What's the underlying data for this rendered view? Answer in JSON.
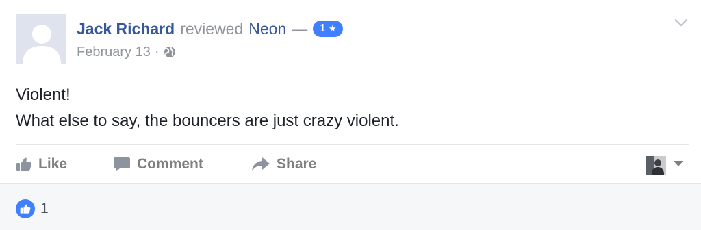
{
  "post": {
    "author": "Jack Richard",
    "verb": "reviewed",
    "page_name": "Neon",
    "dash": "—",
    "rating_value": "1",
    "rating_star": "★",
    "date": "February 13",
    "date_separator": "·",
    "text_lines": [
      "Violent!",
      "What else to say, the bouncers are just crazy violent."
    ]
  },
  "actions": {
    "like_label": "Like",
    "comment_label": "Comment",
    "share_label": "Share"
  },
  "reactions": {
    "count": "1"
  },
  "icons": {
    "privacy": "globe-icon",
    "menu": "chevron-down-icon",
    "like": "thumbs-up-icon",
    "comment": "speech-bubble-icon",
    "share": "share-arrow-icon",
    "audience": "caret-down-icon"
  },
  "colors": {
    "link": "#365899",
    "muted": "#90949c",
    "badge": "#4080ff",
    "action": "#7f7f7f",
    "footer_bg": "#f6f7f9"
  }
}
